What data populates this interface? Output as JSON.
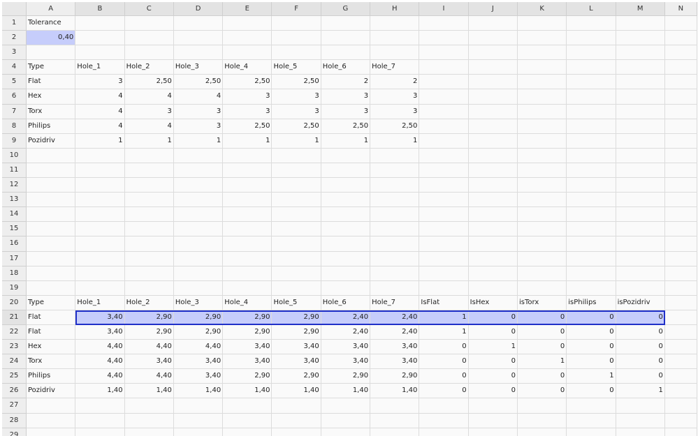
{
  "columns": [
    "A",
    "B",
    "C",
    "D",
    "E",
    "F",
    "G",
    "H",
    "I",
    "J",
    "K",
    "L",
    "M",
    "N"
  ],
  "rows": [
    [
      "Tolerance",
      "",
      "",
      "",
      "",
      "",
      "",
      "",
      "",
      "",
      "",
      "",
      "",
      ""
    ],
    [
      "0,40",
      "",
      "",
      "",
      "",
      "",
      "",
      "",
      "",
      "",
      "",
      "",
      "",
      ""
    ],
    [
      "",
      "",
      "",
      "",
      "",
      "",
      "",
      "",
      "",
      "",
      "",
      "",
      "",
      ""
    ],
    [
      "Type",
      "Hole_1",
      "Hole_2",
      "Hole_3",
      "Hole_4",
      "Hole_5",
      "Hole_6",
      "Hole_7",
      "",
      "",
      "",
      "",
      "",
      ""
    ],
    [
      "Flat",
      "3",
      "2,50",
      "2,50",
      "2,50",
      "2,50",
      "2",
      "2",
      "",
      "",
      "",
      "",
      "",
      ""
    ],
    [
      "Hex",
      "4",
      "4",
      "4",
      "3",
      "3",
      "3",
      "3",
      "",
      "",
      "",
      "",
      "",
      ""
    ],
    [
      "Torx",
      "4",
      "3",
      "3",
      "3",
      "3",
      "3",
      "3",
      "",
      "",
      "",
      "",
      "",
      ""
    ],
    [
      "Philips",
      "4",
      "4",
      "3",
      "2,50",
      "2,50",
      "2,50",
      "2,50",
      "",
      "",
      "",
      "",
      "",
      ""
    ],
    [
      "Pozidriv",
      "1",
      "1",
      "1",
      "1",
      "1",
      "1",
      "1",
      "",
      "",
      "",
      "",
      "",
      ""
    ],
    [
      "",
      "",
      "",
      "",
      "",
      "",
      "",
      "",
      "",
      "",
      "",
      "",
      "",
      ""
    ],
    [
      "",
      "",
      "",
      "",
      "",
      "",
      "",
      "",
      "",
      "",
      "",
      "",
      "",
      ""
    ],
    [
      "",
      "",
      "",
      "",
      "",
      "",
      "",
      "",
      "",
      "",
      "",
      "",
      "",
      ""
    ],
    [
      "",
      "",
      "",
      "",
      "",
      "",
      "",
      "",
      "",
      "",
      "",
      "",
      "",
      ""
    ],
    [
      "",
      "",
      "",
      "",
      "",
      "",
      "",
      "",
      "",
      "",
      "",
      "",
      "",
      ""
    ],
    [
      "",
      "",
      "",
      "",
      "",
      "",
      "",
      "",
      "",
      "",
      "",
      "",
      "",
      ""
    ],
    [
      "",
      "",
      "",
      "",
      "",
      "",
      "",
      "",
      "",
      "",
      "",
      "",
      "",
      ""
    ],
    [
      "",
      "",
      "",
      "",
      "",
      "",
      "",
      "",
      "",
      "",
      "",
      "",
      "",
      ""
    ],
    [
      "",
      "",
      "",
      "",
      "",
      "",
      "",
      "",
      "",
      "",
      "",
      "",
      "",
      ""
    ],
    [
      "",
      "",
      "",
      "",
      "",
      "",
      "",
      "",
      "",
      "",
      "",
      "",
      "",
      ""
    ],
    [
      "Type",
      "Hole_1",
      "Hole_2",
      "Hole_3",
      "Hole_4",
      "Hole_5",
      "Hole_6",
      "Hole_7",
      "IsFlat",
      "IsHex",
      "isTorx",
      "isPhilips",
      "isPozidriv",
      ""
    ],
    [
      "Flat",
      "3,40",
      "2,90",
      "2,90",
      "2,90",
      "2,90",
      "2,40",
      "2,40",
      "1",
      "0",
      "0",
      "0",
      "0",
      ""
    ],
    [
      "Flat",
      "3,40",
      "2,90",
      "2,90",
      "2,90",
      "2,90",
      "2,40",
      "2,40",
      "1",
      "0",
      "0",
      "0",
      "0",
      ""
    ],
    [
      "Hex",
      "4,40",
      "4,40",
      "4,40",
      "3,40",
      "3,40",
      "3,40",
      "3,40",
      "0",
      "1",
      "0",
      "0",
      "0",
      ""
    ],
    [
      "Torx",
      "4,40",
      "3,40",
      "3,40",
      "3,40",
      "3,40",
      "3,40",
      "3,40",
      "0",
      "0",
      "1",
      "0",
      "0",
      ""
    ],
    [
      "Philips",
      "4,40",
      "4,40",
      "3,40",
      "2,90",
      "2,90",
      "2,90",
      "2,90",
      "0",
      "0",
      "0",
      "1",
      "0",
      ""
    ],
    [
      "Pozidriv",
      "1,40",
      "1,40",
      "1,40",
      "1,40",
      "1,40",
      "1,40",
      "1,40",
      "0",
      "0",
      "0",
      "0",
      "1",
      ""
    ],
    [
      "",
      "",
      "",
      "",
      "",
      "",
      "",
      "",
      "",
      "",
      "",
      "",
      "",
      ""
    ],
    [
      "",
      "",
      "",
      "",
      "",
      "",
      "",
      "",
      "",
      "",
      "",
      "",
      "",
      ""
    ],
    [
      "",
      "",
      "",
      "",
      "",
      "",
      "",
      "",
      "",
      "",
      "",
      "",
      "",
      ""
    ]
  ],
  "selection": {
    "range": "B21:M21",
    "row": 21
  },
  "highlighted_cell": "A2",
  "colors": {
    "selection_fill": "#c6cdfb",
    "selection_border": "#2030c8",
    "header_bg": "#eeeeee",
    "grid_line": "#dcdcdc"
  }
}
